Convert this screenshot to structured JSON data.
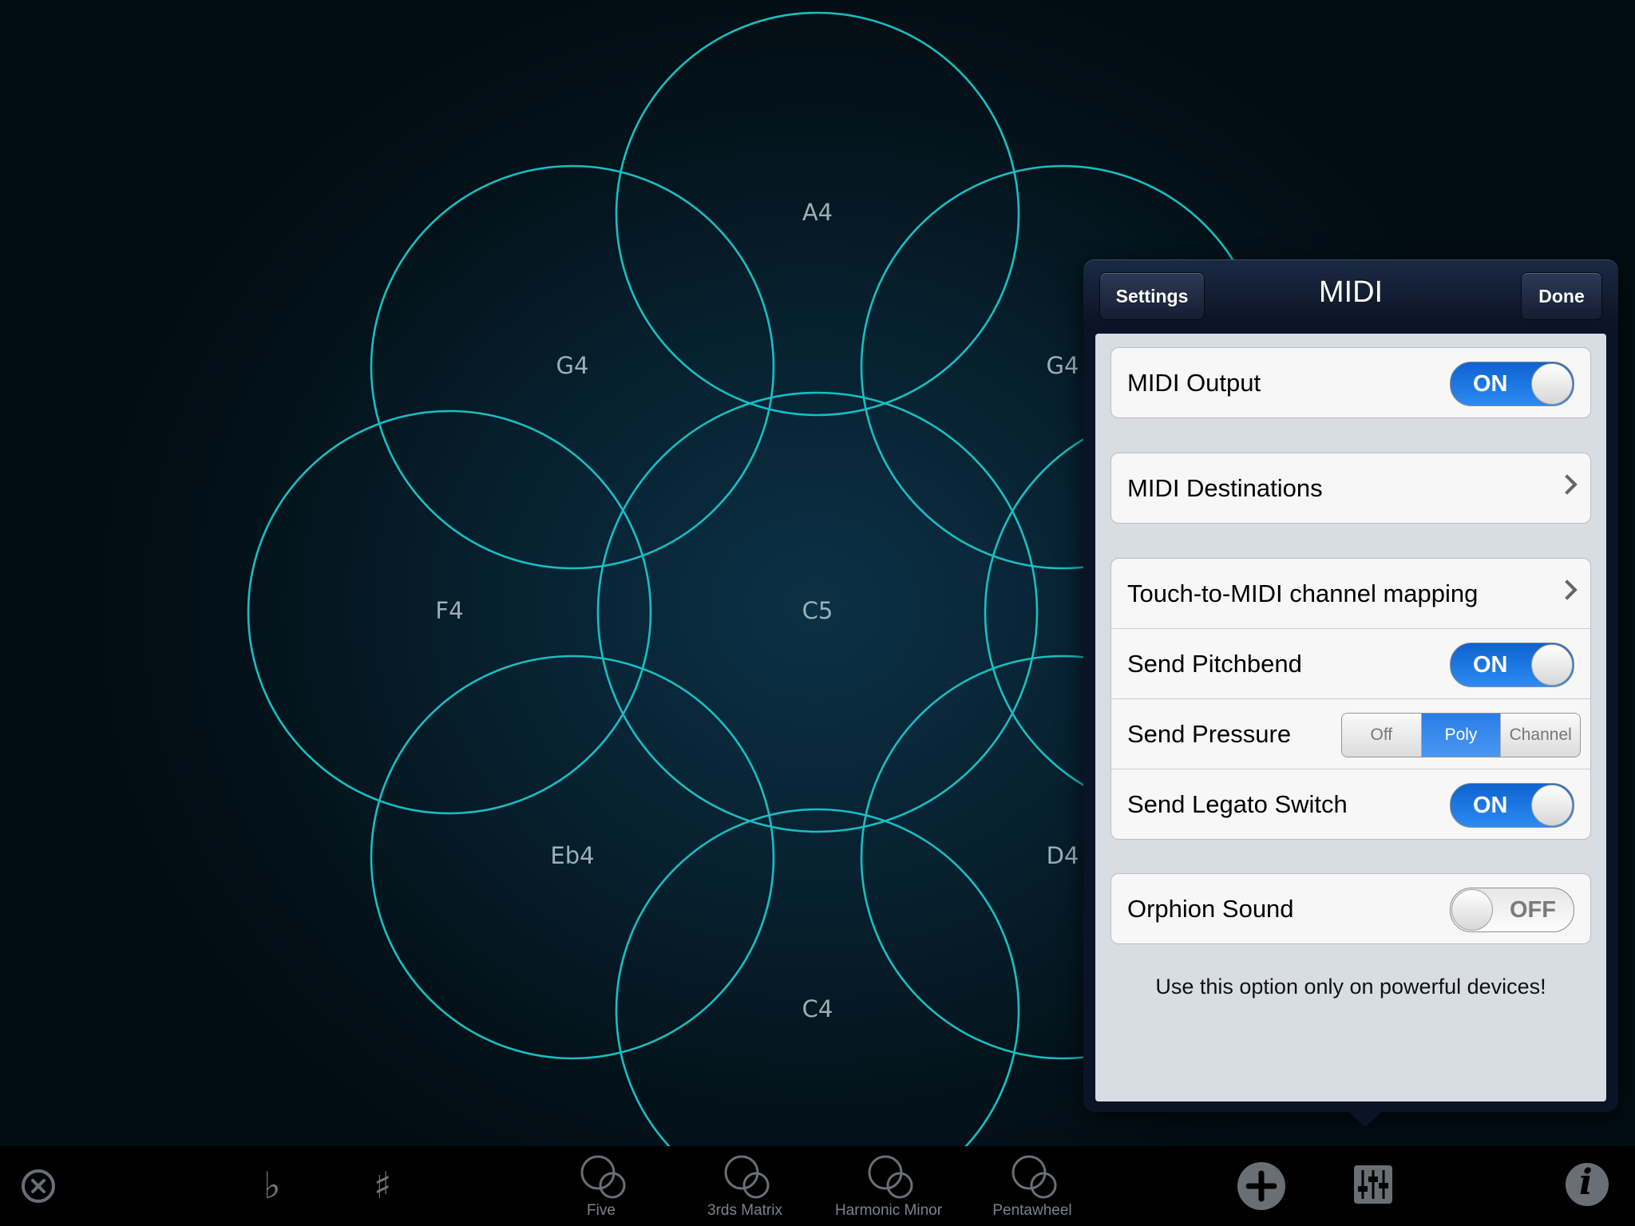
{
  "notes": [
    {
      "id": "A4",
      "label": "A4"
    },
    {
      "id": "G4-left",
      "label": "G4"
    },
    {
      "id": "G4-right",
      "label": "G4"
    },
    {
      "id": "F4",
      "label": "F4"
    },
    {
      "id": "C5",
      "label": "C5"
    },
    {
      "id": "Eb4",
      "label": "Eb4"
    },
    {
      "id": "D4",
      "label": "D4"
    },
    {
      "id": "C4",
      "label": "C4"
    }
  ],
  "toolbar": {
    "close_icon": "close-circle-icon",
    "flat_glyph": "♭",
    "sharp_glyph": "♯",
    "presets": [
      "Five",
      "3rds Matrix",
      "Harmonic Minor",
      "Pentawheel"
    ],
    "add_icon": "plus-circle-icon",
    "mixer_icon": "sliders-icon",
    "info_glyph": "i"
  },
  "popover": {
    "title": "MIDI",
    "back_label": "Settings",
    "done_label": "Done",
    "midi_output": {
      "label": "MIDI Output",
      "state": "ON"
    },
    "midi_destinations": {
      "label": "MIDI Destinations"
    },
    "touch_mapping": {
      "label": "Touch-to-MIDI channel mapping"
    },
    "send_pitchbend": {
      "label": "Send Pitchbend",
      "state": "ON"
    },
    "send_pressure": {
      "label": "Send Pressure",
      "options": [
        "Off",
        "Poly",
        "Channel"
      ],
      "selected": "Poly"
    },
    "send_legato": {
      "label": "Send Legato Switch",
      "state": "ON"
    },
    "orphion_sound": {
      "label": "Orphion Sound",
      "state": "OFF"
    },
    "footer_note": "Use this option only on powerful devices!"
  },
  "colors": {
    "circle_stroke": "#16bfc2",
    "toggle_on": "#2c8bf2",
    "segment_selected": "#2a7de8"
  }
}
